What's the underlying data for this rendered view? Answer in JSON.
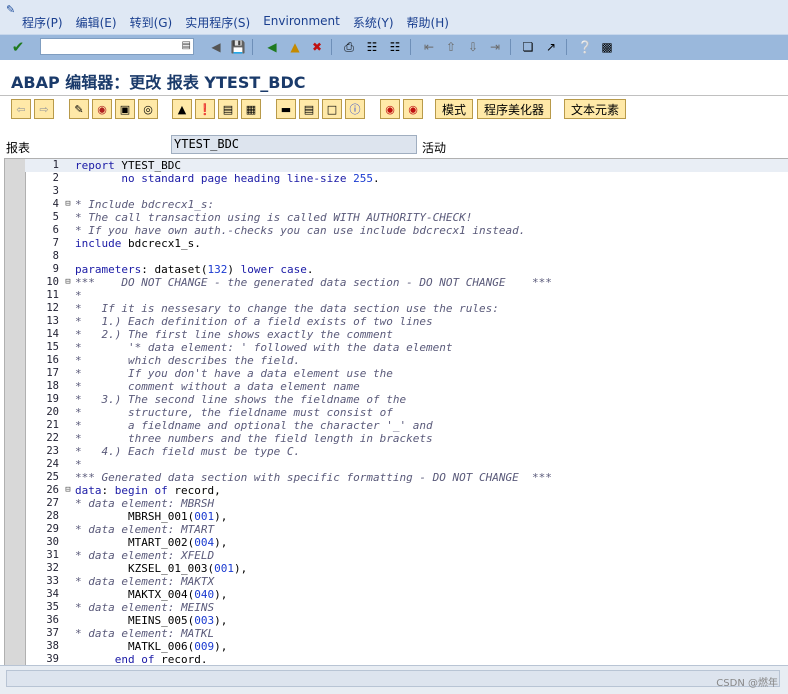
{
  "menu": {
    "items": [
      "程序(P)",
      "编辑(E)",
      "转到(G)",
      "实用程序(S)",
      "Environment",
      "系统(Y)",
      "帮助(H)"
    ]
  },
  "toolbar1": {
    "command_value": "",
    "icons": [
      "enter-icon",
      "save-icon",
      "back-icon",
      "exit-icon",
      "cancel-icon",
      "print-icon",
      "find-icon",
      "find-next-icon",
      "first-page-icon",
      "prev-page-icon",
      "next-page-icon",
      "last-page-icon",
      "new-session-icon",
      "shortcut-icon",
      "help-icon",
      "layout-icon"
    ]
  },
  "title": "ABAP 编辑器：更改 报表 YTEST_BDC",
  "toolbar2": {
    "mode_label": "模式",
    "pretty_printer_label": "程序美化器",
    "text_elements_label": "文本元素"
  },
  "field": {
    "label": "报表",
    "value": "YTEST_BDC",
    "status": "活动"
  },
  "code_lines": [
    [
      {
        "t": "report",
        "c": "kw"
      },
      {
        "t": " YTEST_BDC",
        "c": "plain"
      }
    ],
    [
      {
        "t": "       no standard page heading line-size ",
        "c": "kw"
      },
      {
        "t": "255",
        "c": "num-lit"
      },
      {
        "t": ".",
        "c": "plain"
      }
    ],
    [],
    [
      {
        "t": "* Include bdcrecx1_s:",
        "c": "cmt"
      }
    ],
    [
      {
        "t": "* The call transaction using is called WITH AUTHORITY-CHECK!",
        "c": "cmt"
      }
    ],
    [
      {
        "t": "* If you have own auth.-checks you can use include bdcrecx1 instead.",
        "c": "cmt"
      }
    ],
    [
      {
        "t": "include",
        "c": "kw"
      },
      {
        "t": " bdcrecx1_s.",
        "c": "plain"
      }
    ],
    [],
    [
      {
        "t": "parameters",
        "c": "kw"
      },
      {
        "t": ": dataset(",
        "c": "plain"
      },
      {
        "t": "132",
        "c": "num-lit"
      },
      {
        "t": ") ",
        "c": "plain"
      },
      {
        "t": "lower case",
        "c": "kw"
      },
      {
        "t": ".",
        "c": "plain"
      }
    ],
    [
      {
        "t": "***    DO NOT CHANGE - the generated data section - DO NOT CHANGE    ***",
        "c": "cmt"
      }
    ],
    [
      {
        "t": "*",
        "c": "cmt"
      }
    ],
    [
      {
        "t": "*   If it is nessesary to change the data section use the rules:",
        "c": "cmt"
      }
    ],
    [
      {
        "t": "*   1.) Each definition of a field exists of two lines",
        "c": "cmt"
      }
    ],
    [
      {
        "t": "*   2.) The first line shows exactly the comment",
        "c": "cmt"
      }
    ],
    [
      {
        "t": "*       '* data element: ' followed with the data element",
        "c": "cmt"
      }
    ],
    [
      {
        "t": "*       which describes the field.",
        "c": "cmt"
      }
    ],
    [
      {
        "t": "*       If you don't have a data element use the",
        "c": "cmt"
      }
    ],
    [
      {
        "t": "*       comment without a data element name",
        "c": "cmt"
      }
    ],
    [
      {
        "t": "*   3.) The second line shows the fieldname of the",
        "c": "cmt"
      }
    ],
    [
      {
        "t": "*       structure, the fieldname must consist of",
        "c": "cmt"
      }
    ],
    [
      {
        "t": "*       a fieldname and optional the character '_' and",
        "c": "cmt"
      }
    ],
    [
      {
        "t": "*       three numbers and the field length in brackets",
        "c": "cmt"
      }
    ],
    [
      {
        "t": "*   4.) Each field must be type C.",
        "c": "cmt"
      }
    ],
    [
      {
        "t": "*",
        "c": "cmt"
      }
    ],
    [
      {
        "t": "*** Generated data section with specific formatting - DO NOT CHANGE  ***",
        "c": "cmt"
      }
    ],
    [
      {
        "t": "data",
        "c": "kw"
      },
      {
        "t": ": ",
        "c": "plain"
      },
      {
        "t": "begin of",
        "c": "kw"
      },
      {
        "t": " record,",
        "c": "plain"
      }
    ],
    [
      {
        "t": "* data element: MBRSH",
        "c": "cmt"
      }
    ],
    [
      {
        "t": "        MBRSH_001(",
        "c": "plain"
      },
      {
        "t": "001",
        "c": "num-lit"
      },
      {
        "t": "),",
        "c": "plain"
      }
    ],
    [
      {
        "t": "* data element: MTART",
        "c": "cmt"
      }
    ],
    [
      {
        "t": "        MTART_002(",
        "c": "plain"
      },
      {
        "t": "004",
        "c": "num-lit"
      },
      {
        "t": "),",
        "c": "plain"
      }
    ],
    [
      {
        "t": "* data element: XFELD",
        "c": "cmt"
      }
    ],
    [
      {
        "t": "        KZSEL_01_003(",
        "c": "plain"
      },
      {
        "t": "001",
        "c": "num-lit"
      },
      {
        "t": "),",
        "c": "plain"
      }
    ],
    [
      {
        "t": "* data element: MAKTX",
        "c": "cmt"
      }
    ],
    [
      {
        "t": "        MAKTX_004(",
        "c": "plain"
      },
      {
        "t": "040",
        "c": "num-lit"
      },
      {
        "t": "),",
        "c": "plain"
      }
    ],
    [
      {
        "t": "* data element: MEINS",
        "c": "cmt"
      }
    ],
    [
      {
        "t": "        MEINS_005(",
        "c": "plain"
      },
      {
        "t": "003",
        "c": "num-lit"
      },
      {
        "t": "),",
        "c": "plain"
      }
    ],
    [
      {
        "t": "* data element: MATKL",
        "c": "cmt"
      }
    ],
    [
      {
        "t": "        MATKL_006(",
        "c": "plain"
      },
      {
        "t": "009",
        "c": "num-lit"
      },
      {
        "t": "),",
        "c": "plain"
      }
    ],
    [
      {
        "t": "      ",
        "c": "plain"
      },
      {
        "t": "end of",
        "c": "kw"
      },
      {
        "t": " record.",
        "c": "plain"
      }
    ]
  ],
  "fold_lines": [
    4,
    10,
    26
  ],
  "watermark": "CSDN @燃年"
}
